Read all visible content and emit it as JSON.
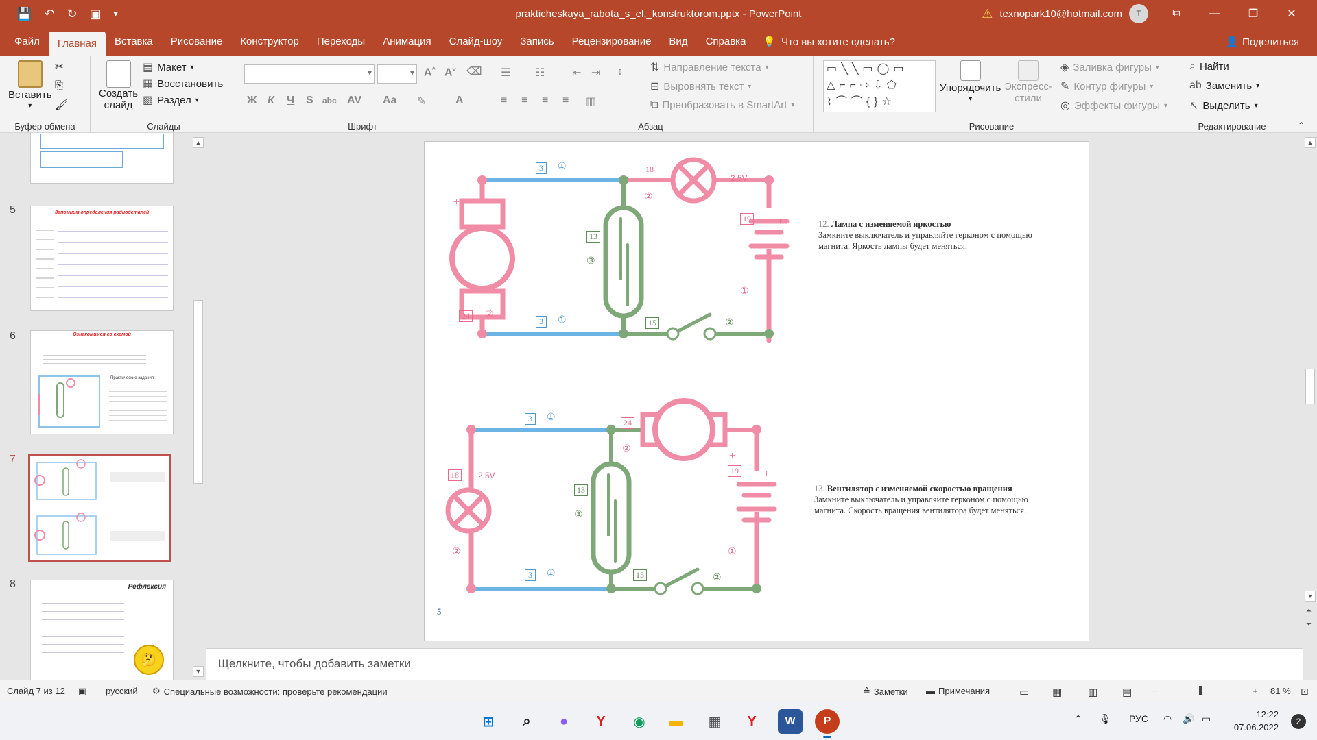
{
  "titlebar": {
    "filename": "prakticheskaya_rabota_s_el._konstruktorom.pptx",
    "separator": "-",
    "app": "PowerPoint",
    "account": "texnopark10@hotmail.com",
    "avatar_letter": "T"
  },
  "tabs": [
    "Файл",
    "Главная",
    "Вставка",
    "Рисование",
    "Конструктор",
    "Переходы",
    "Анимация",
    "Слайд-шоу",
    "Запись",
    "Рецензирование",
    "Вид",
    "Справка"
  ],
  "active_tab": "Главная",
  "tellme": "Что вы хотите сделать?",
  "share": "Поделиться",
  "ribbon": {
    "clipboard": {
      "paste": "Вставить",
      "label": "Буфер обмена"
    },
    "slides": {
      "new_slide_1": "Создать",
      "new_slide_2": "слайд",
      "layout": "Макет",
      "reset": "Восстановить",
      "section": "Раздел",
      "label": "Слайды"
    },
    "font": {
      "label": "Шрифт",
      "bold": "Ж",
      "italic": "К",
      "underline": "Ч",
      "shadow": "S",
      "strike": "abc",
      "spacing": "AV",
      "case": "Aa",
      "color": "A"
    },
    "paragraph": {
      "text_direction": "Направление текста",
      "align_text": "Выровнять текст",
      "smartart": "Преобразовать в SmartArt",
      "label": "Абзац"
    },
    "drawing": {
      "arrange": "Упорядочить",
      "quick_styles_1": "Экспресс-",
      "quick_styles_2": "стили",
      "fill": "Заливка фигуры",
      "outline": "Контур фигуры",
      "effects": "Эффекты фигуры",
      "label": "Рисование"
    },
    "editing": {
      "find": "Найти",
      "replace": "Заменить",
      "select": "Выделить",
      "label": "Редактирование"
    }
  },
  "thumbnails": [
    {
      "num": "5",
      "title": "Запомним определения радиодеталей"
    },
    {
      "num": "6",
      "title": "Ознакомимся со схемой",
      "subtitle": "Практические задания:"
    },
    {
      "num": "7"
    },
    {
      "num": "8",
      "title": "Рефлексия"
    }
  ],
  "slide": {
    "item12_num": "12.",
    "item12_title": "Лампа с изменяемой яркостью",
    "item12_text_1": "Замкните выключатель и управляйте герконом с помощью",
    "item12_text_2": "магнита. Яркость лампы будет меняться.",
    "item13_num": "13.",
    "item13_title": "Вентилятор с изменяемой скоростью вращения",
    "item13_text_1": "Замкните выключатель и управляйте герконом с помощью",
    "item13_text_2": "магнита. Скорость вращения вентилятора будет меняться.",
    "page_num": "5",
    "c1": {
      "n3a": "3",
      "c1a": "①",
      "n18": "18",
      "c2a": "②",
      "v": "2.5V",
      "plus_bat": "+",
      "n19": "19",
      "n13": "13",
      "c3": "③",
      "c1b": "①",
      "plus_motor": "+",
      "n24": "24",
      "c2b": "②",
      "n3b": "3",
      "c1c": "①",
      "n15": "15",
      "c2c": "②"
    },
    "c2": {
      "n3a": "3",
      "c1a": "①",
      "n24": "24",
      "c2a": "②",
      "plus_motor": "+",
      "n19": "19",
      "plus_bat": "+",
      "n18": "18",
      "v": "2.5V",
      "n13": "13",
      "c3": "③",
      "c1b": "①",
      "c2b": "②",
      "n3b": "3",
      "c1c": "①",
      "n15": "15",
      "c2c": "②"
    }
  },
  "notes_placeholder": "Щелкните, чтобы добавить заметки",
  "status": {
    "slide_of": "Слайд 7 из 12",
    "language": "русский",
    "accessibility": "Специальные возможности: проверьте рекомендации",
    "notes": "Заметки",
    "comments": "Примечания",
    "zoom_minus": "−",
    "zoom_plus": "+",
    "zoom": "81 %"
  },
  "taskbar": {
    "lang": "РУС",
    "time": "12:22",
    "date": "07.06.2022",
    "notifications": "2"
  },
  "colors": {
    "accent": "#b7472a",
    "pink": "#f08ca6",
    "blue": "#6cb4e4",
    "green": "#7fa878",
    "selected_slide": "#c0504d"
  }
}
